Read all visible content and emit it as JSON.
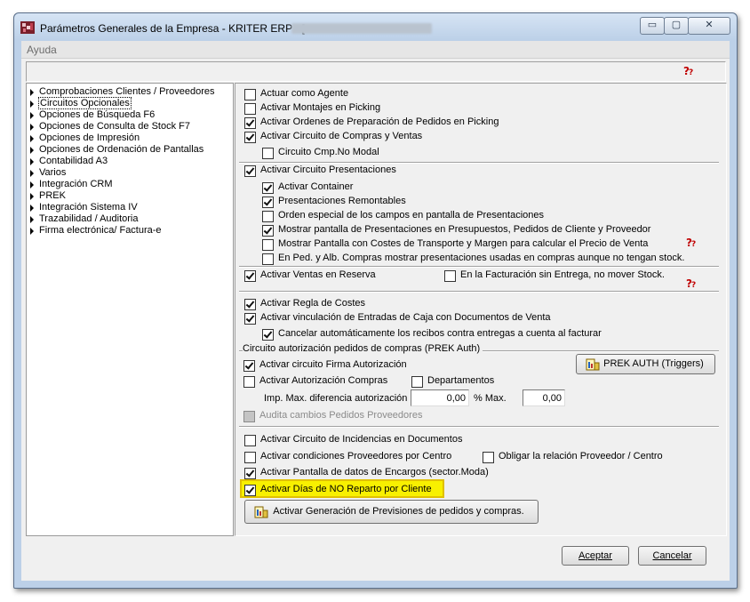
{
  "window": {
    "title": "Parámetros Generales de la Empresa - KRITER ERP - [",
    "controls": {
      "minimize": "▭",
      "maximize": "▢",
      "close": "✕"
    }
  },
  "menu": {
    "help": "Ayuda"
  },
  "tree": [
    "Comprobaciones Clientes / Proveedores",
    "Circuitos Opcionales",
    "Opciones de Búsqueda F6",
    "Opciones de Consulta de Stock F7",
    "Opciones de Impresión",
    "Opciones de Ordenación de Pantallas",
    "Contabilidad A3",
    "Varios",
    "Integración CRM",
    "PREK",
    "Integración Sistema IV",
    "Trazabilidad / Auditoria",
    "Firma electrónica/ Factura-e"
  ],
  "options": {
    "actuar_agente": {
      "label": "Actuar como Agente",
      "checked": false
    },
    "montajes_picking": {
      "label": "Activar Montajes en Picking",
      "checked": false
    },
    "ordenes_preparacion": {
      "label": "Activar Ordenes de Preparación de Pedidos en Picking",
      "checked": true
    },
    "circuito_compras_ventas": {
      "label": "Activar Circuito de Compras y Ventas",
      "checked": true
    },
    "circuito_cmp_no_modal": {
      "label": "Circuito Cmp.No Modal",
      "checked": false
    },
    "circuito_presentaciones": {
      "label": "Activar Circuito Presentaciones",
      "checked": true
    },
    "activar_container": {
      "label": "Activar Container",
      "checked": true
    },
    "presentaciones_remontables": {
      "label": "Presentaciones Remontables",
      "checked": true
    },
    "orden_especial": {
      "label": "Orden especial de los campos en pantalla de Presentaciones",
      "checked": false
    },
    "mostrar_presentaciones": {
      "label": "Mostrar pantalla de Presentaciones en Presupuestos, Pedidos de Cliente y Proveedor",
      "checked": true
    },
    "mostrar_costes": {
      "label": "Mostrar Pantalla con Costes de Transporte y Margen para calcular el Precio de Venta",
      "checked": false
    },
    "ped_alb_compras": {
      "label": "En Ped. y Alb. Compras mostrar presentaciones usadas en compras aunque no tengan stock.",
      "checked": false
    },
    "ventas_reserva": {
      "label": "Activar Ventas en Reserva",
      "checked": true
    },
    "facturacion_sin_entrega": {
      "label": "En la Facturación sin Entrega, no mover Stock.",
      "checked": false
    },
    "regla_costes": {
      "label": "Activar Regla de Costes",
      "checked": true
    },
    "vinculacion_caja": {
      "label": "Activar vinculación de Entradas de Caja con Documentos de Venta",
      "checked": true
    },
    "cancelar_recibos": {
      "label": "Cancelar automáticamente los recibos contra entregas a cuenta al facturar",
      "checked": true
    }
  },
  "prek_group": {
    "title": "Circuito autorización  pedidos de compras (PREK Auth)",
    "firma_autorizacion": {
      "label": "Activar circuito Firma Autorización",
      "checked": true
    },
    "autorizacion_compras": {
      "label": "Activar Autorización Compras",
      "checked": false
    },
    "departamentos": {
      "label": "Departamentos",
      "checked": false
    },
    "imp_max_label": "Imp. Max. diferencia autorización",
    "imp_max_value": "0,00",
    "pct_max_label": "% Max.",
    "pct_max_value": "0,00",
    "audita_cambios": {
      "label": "Audita cambios Pedidos Proveedores",
      "checked": false,
      "disabled": true
    },
    "prek_button": "PREK AUTH  (Triggers)"
  },
  "bottom_options": {
    "incidencias": {
      "label": "Activar Circuito de Incidencias en Documentos",
      "checked": false
    },
    "condiciones_proveedores": {
      "label": "Activar condiciones Proveedores por Centro",
      "checked": false
    },
    "obligar_relacion": {
      "label": "Obligar la relación Proveedor / Centro",
      "checked": false
    },
    "pantalla_encargos": {
      "label": "Activar Pantalla de datos de Encargos (sector.Moda)",
      "checked": true
    },
    "dias_no_reparto": {
      "label": "Activar Días de NO Reparto por Cliente",
      "checked": true
    }
  },
  "previsiones_button": "Activar Generación de Previsiones de pedidos y compras.",
  "dialog_buttons": {
    "accept": "Aceptar",
    "cancel": "Cancelar"
  },
  "colors": {
    "highlight": "#f8f000",
    "highlight_border": "#e0c000"
  }
}
